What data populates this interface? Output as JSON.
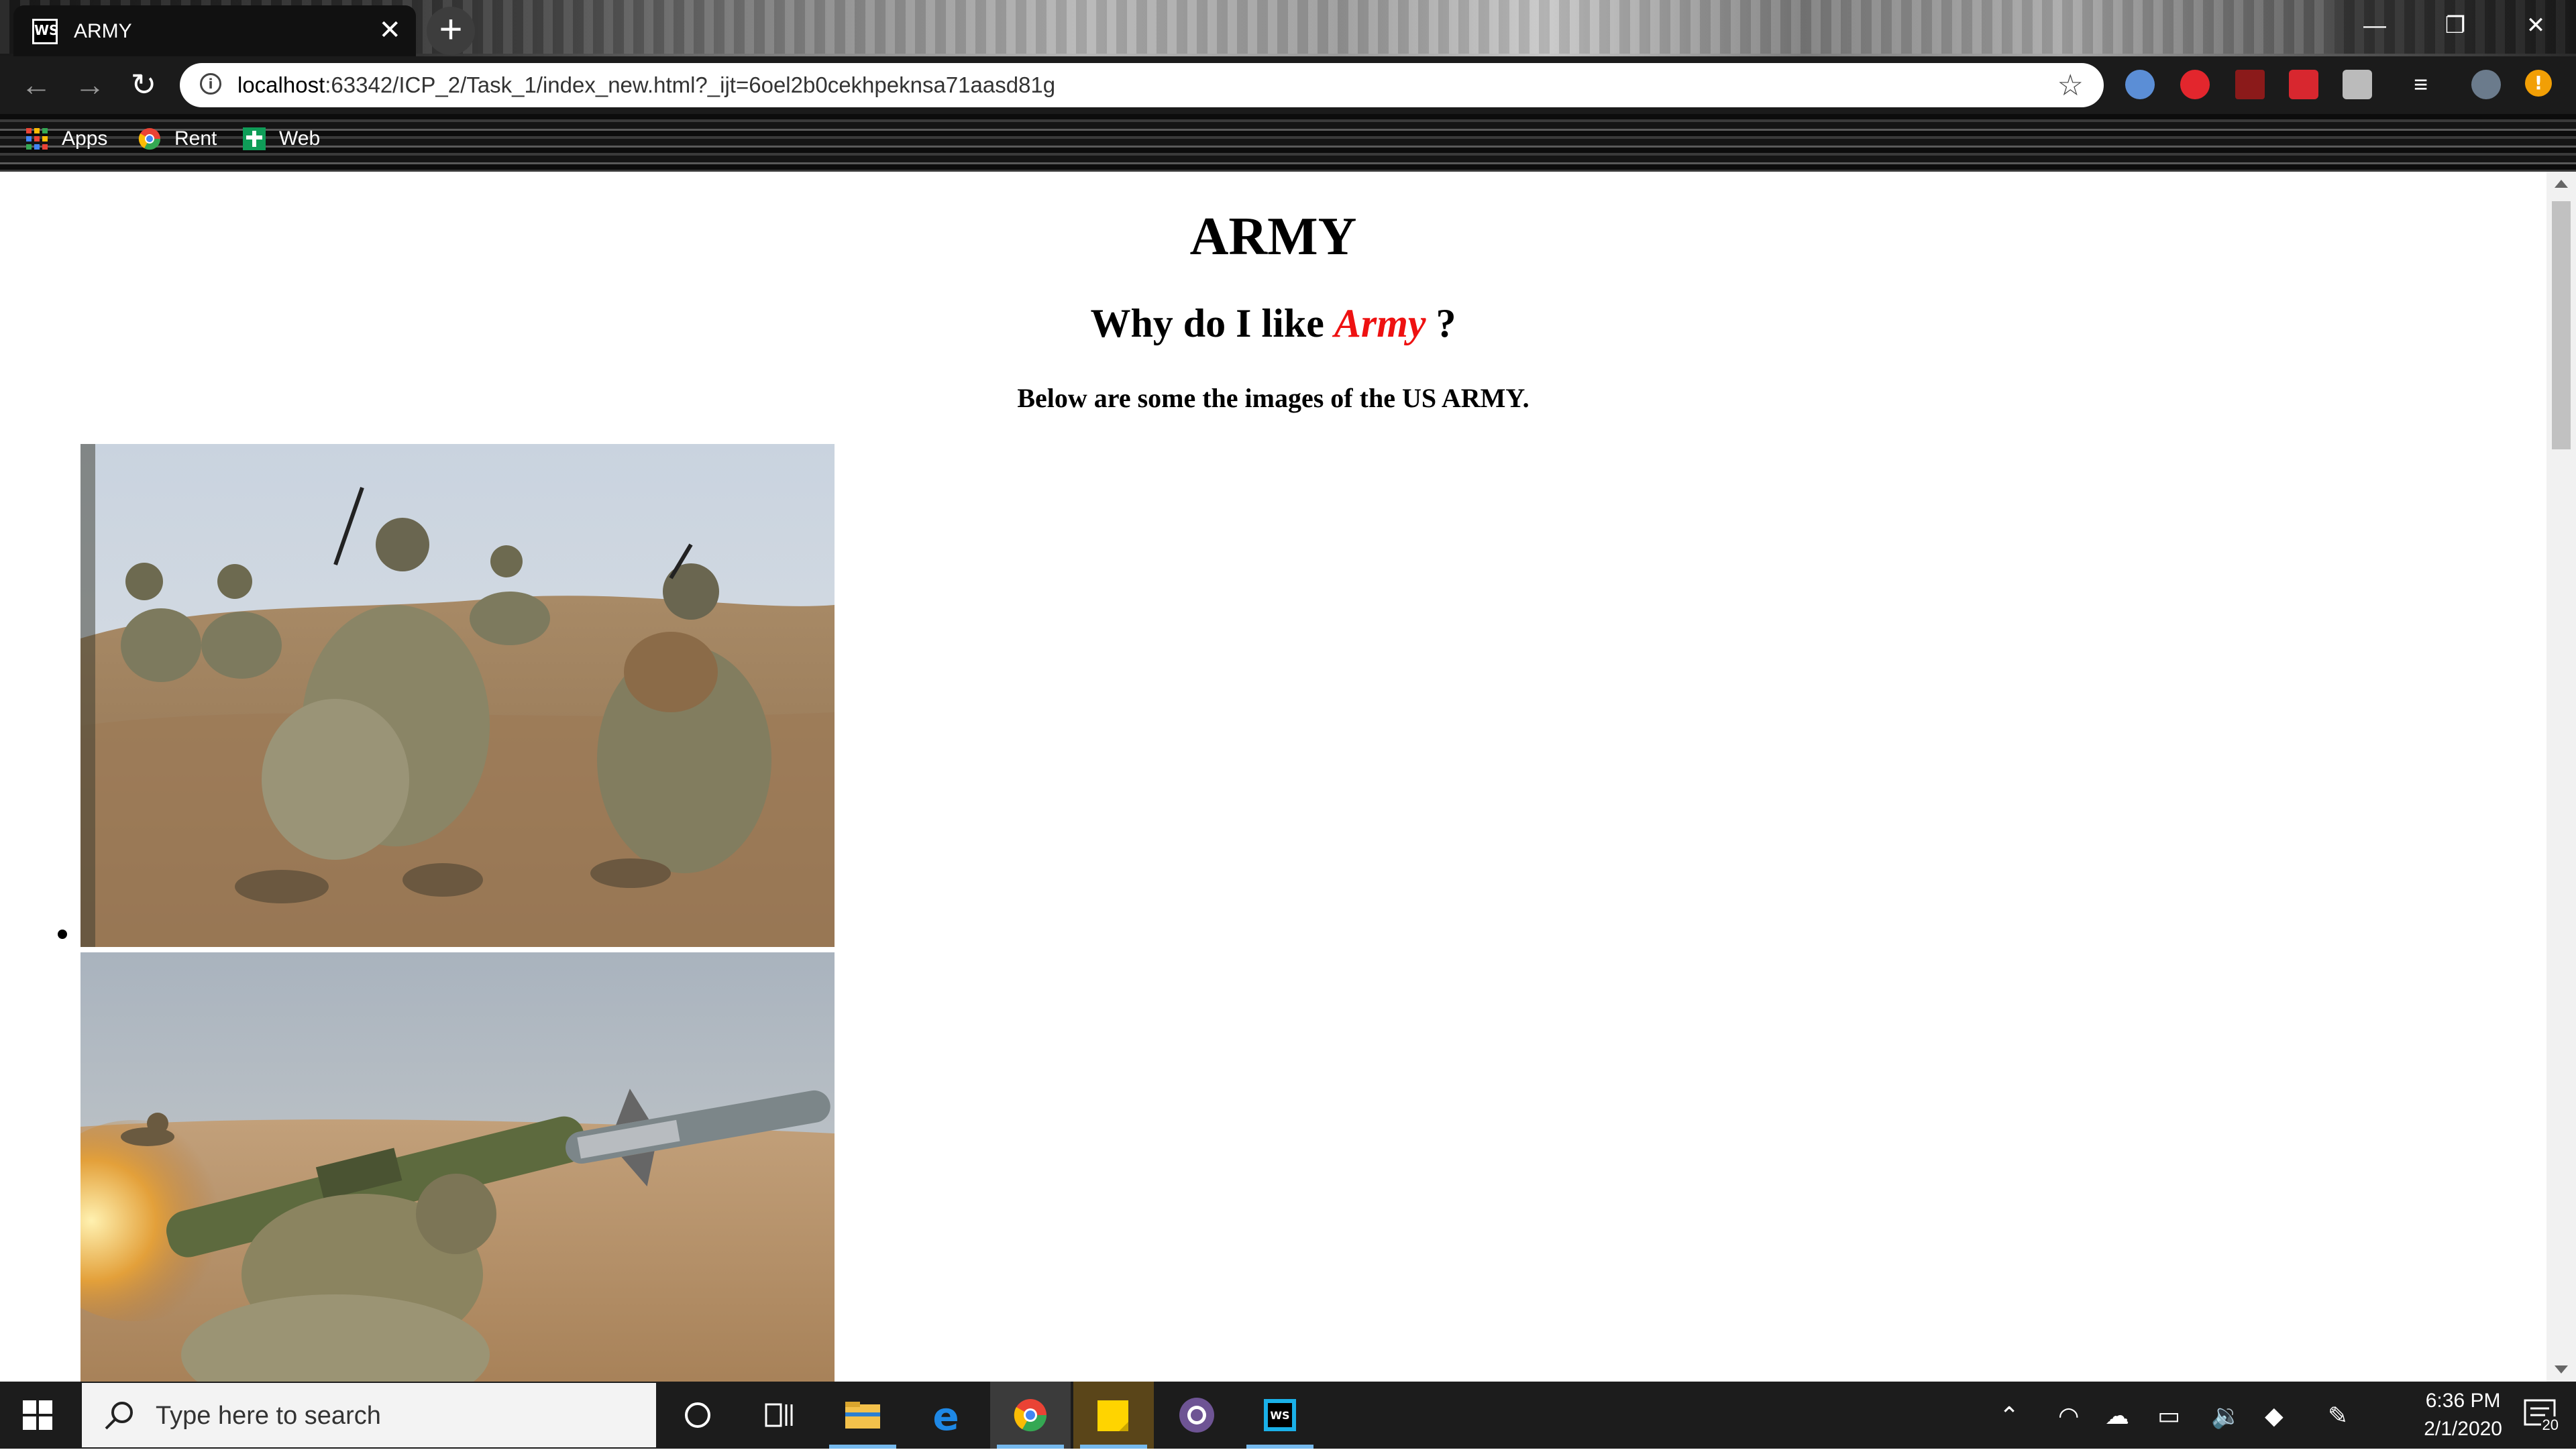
{
  "browser": {
    "tab_title": "ARMY",
    "tab_favicon_text": "WS",
    "close_glyph": "✕",
    "new_tab_glyph": "+",
    "url_host": "localhost",
    "url_rest": ":63342/ICP_2/Task_1/index_new.html?_ijt=6oel2b0cekhpeknsa71aasd81g",
    "bookmarks": [
      {
        "label": "Apps",
        "icon": "apps-grid-icon"
      },
      {
        "label": "Rent",
        "icon": "chrome-icon"
      },
      {
        "label": "Web",
        "icon": "web-plus-icon"
      }
    ],
    "window_controls": {
      "minimize": "—",
      "restore": "❐",
      "close": "✕"
    }
  },
  "page": {
    "title": "ARMY",
    "subtitle_prefix": "Why do I like ",
    "subtitle_highlight": "Army",
    "subtitle_suffix": " ?",
    "intro": "Below are some the images of the US ARMY.",
    "highlight_color": "#ee1111",
    "images": [
      {
        "description_icon": "soldiers-kneeling-photo"
      },
      {
        "description_icon": "javelin-launch-photo"
      }
    ]
  },
  "taskbar": {
    "search_placeholder": "Type here to search",
    "time": "6:36 PM",
    "date": "2/1/2020",
    "notification_count": "20",
    "apps": [
      "task-view",
      "file-explorer",
      "edge",
      "chrome",
      "sticky-notes",
      "github",
      "webstorm"
    ]
  }
}
